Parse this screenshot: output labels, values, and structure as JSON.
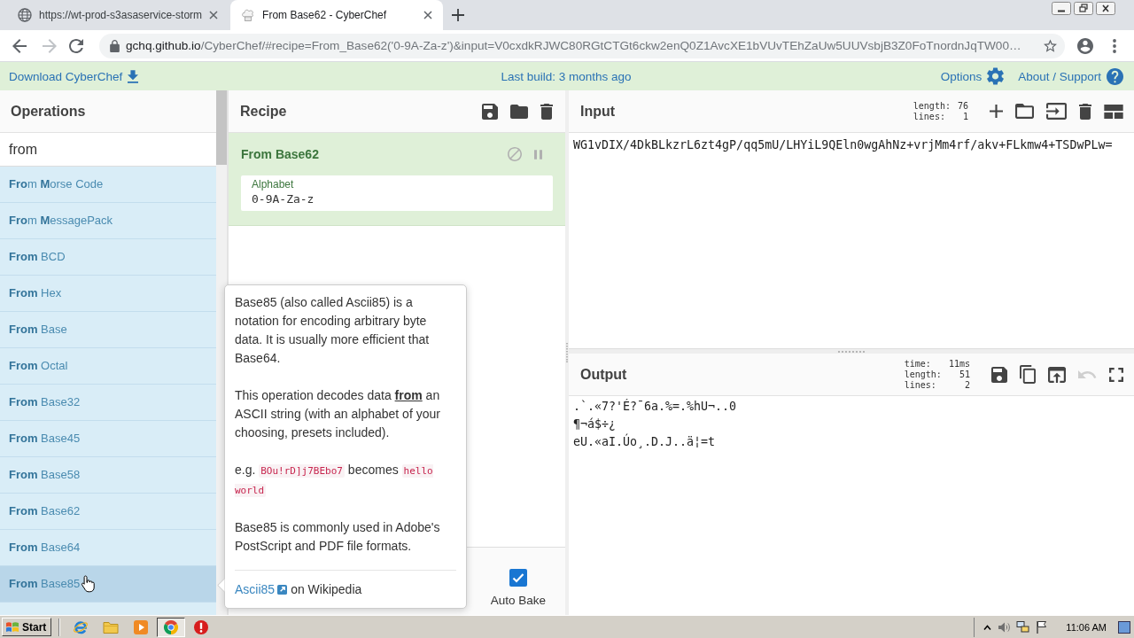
{
  "browser": {
    "tabs": [
      {
        "title": "https://wt-prod-s3asaservice-storm",
        "selected": false
      },
      {
        "title": "From Base62 - CyberChef",
        "selected": true
      }
    ],
    "forward_disabled": true,
    "address": {
      "host": "gchq.github.io",
      "path": "/CyberChef/#recipe=From_Base62('0-9A-Za-z')&input=V0cxdkRJWC80RGtCTGt6ckw2enQ0Z1AvcXE1bVUvTEhZaUw5UUVsbjB3Z0FoTnordnJqTW00…"
    }
  },
  "banner": {
    "download": "Download CyberChef",
    "build": "Last build: 3 months ago",
    "options": "Options",
    "about": "About / Support"
  },
  "operations": {
    "title": "Operations",
    "search": "from",
    "items": [
      {
        "label": "**Fro**m **M**orse Code",
        "hovered": false
      },
      {
        "label": "**Fro**m **M**essagePack",
        "hovered": false
      },
      {
        "label": "**From** BCD",
        "hovered": false
      },
      {
        "label": "**From** Hex",
        "hovered": false
      },
      {
        "label": "**From** Base",
        "hovered": false
      },
      {
        "label": "**From** Octal",
        "hovered": false
      },
      {
        "label": "**From** Base32",
        "hovered": false
      },
      {
        "label": "**From** Base45",
        "hovered": false
      },
      {
        "label": "**From** Base58",
        "hovered": false
      },
      {
        "label": "**From** Base62",
        "hovered": false
      },
      {
        "label": "**From** Base64",
        "hovered": false
      },
      {
        "label": "**From** Base85",
        "hovered": true
      }
    ]
  },
  "recipe": {
    "title": "Recipe",
    "steps": [
      {
        "name": "From Base62",
        "args": [
          {
            "label": "Alphabet",
            "value": "0-9A-Za-z"
          }
        ]
      }
    ],
    "auto_bake": {
      "label": "Auto Bake",
      "checked": true
    }
  },
  "input": {
    "title": "Input",
    "stats": [
      {
        "label": "length:",
        "value": "76"
      },
      {
        "label": "lines:",
        "value": "1"
      }
    ],
    "text": "WG1vDIX/4DkBLkzrL6zt4gP/qq5mU/LHYiL9QEln0wgAhNz+vrjMm4rf/akv+FLkmw4+TSDwPLw="
  },
  "output": {
    "title": "Output",
    "stats": [
      {
        "label": "time:",
        "value": "11ms"
      },
      {
        "label": "length:",
        "value": "51"
      },
      {
        "label": "lines:",
        "value": "2"
      }
    ],
    "undo_disabled": true,
    "lines": [
      ".`.«7?'É?¯6a.%=.%hU¬..0",
      "¶¬á$÷¿",
      "eU.«aI.Úo¸.D.J..ä¦=t"
    ]
  },
  "tooltip": {
    "paragraphs": [
      {
        "kind": "text",
        "text": "Base85 (also called Ascii85) is a notation for encoding arbitrary byte data. It is usually more efficient that Base64."
      },
      {
        "kind": "text",
        "text": "This operation decodes data **from** an ASCII string (with an alphabet of your choosing, presets included)."
      },
      {
        "kind": "example",
        "parts": [
          {
            "kind": "text",
            "text": "e.g. "
          },
          {
            "kind": "code",
            "text": "BOu!rD]j7BEbo7"
          },
          {
            "kind": "text",
            "text": " becomes "
          },
          {
            "kind": "code",
            "text": "hello world"
          }
        ]
      },
      {
        "kind": "text",
        "text": "Base85 is commonly used in Adobe's PostScript and PDF file formats."
      }
    ],
    "link": {
      "text": "Ascii85",
      "suffix": "on Wikipedia"
    }
  },
  "taskbar": {
    "start": "Start",
    "apps": [
      {
        "kind": "browser-e",
        "selected": false
      },
      {
        "kind": "folder",
        "selected": false
      },
      {
        "kind": "media",
        "selected": false
      },
      {
        "kind": "browser-round",
        "selected": true
      },
      {
        "kind": "alert",
        "selected": false
      }
    ],
    "clock": "11:06 AM"
  }
}
